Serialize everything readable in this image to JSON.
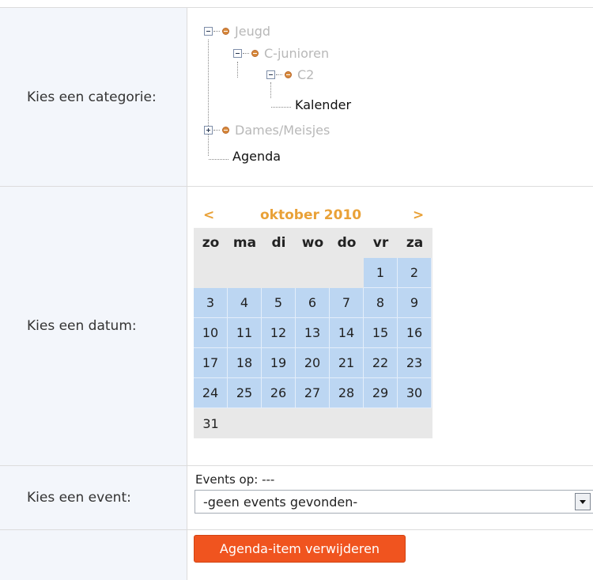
{
  "form": {
    "category_label": "Kies een categorie:",
    "date_label": "Kies een datum:",
    "event_label": "Kies een event:"
  },
  "tree": {
    "nodes": [
      {
        "label": "Jeugd"
      },
      {
        "label": "C-junioren"
      },
      {
        "label": "C2"
      },
      {
        "label": "Kalender"
      },
      {
        "label": "Dames/Meisjes"
      },
      {
        "label": "Agenda"
      }
    ]
  },
  "calendar": {
    "prev": "<",
    "next": ">",
    "month_title": "oktober 2010",
    "weekdays": [
      "zo",
      "ma",
      "di",
      "wo",
      "do",
      "vr",
      "za"
    ],
    "weeks": [
      [
        "",
        "",
        "",
        "",
        "",
        "1",
        "2"
      ],
      [
        "3",
        "4",
        "5",
        "6",
        "7",
        "8",
        "9"
      ],
      [
        "10",
        "11",
        "12",
        "13",
        "14",
        "15",
        "16"
      ],
      [
        "17",
        "18",
        "19",
        "20",
        "21",
        "22",
        "23"
      ],
      [
        "24",
        "25",
        "26",
        "27",
        "28",
        "29",
        "30"
      ],
      [
        "31",
        "",
        "",
        "",
        "",
        "",
        ""
      ]
    ]
  },
  "events": {
    "events_on_label": "Events op: ---",
    "select_value": "-geen events gevonden-"
  },
  "actions": {
    "delete_label": "Agenda-item verwijderen"
  },
  "colors": {
    "accent_orange": "#e9a137",
    "day_cell_blue": "#bcd6f2",
    "button_red": "#f0541f"
  }
}
